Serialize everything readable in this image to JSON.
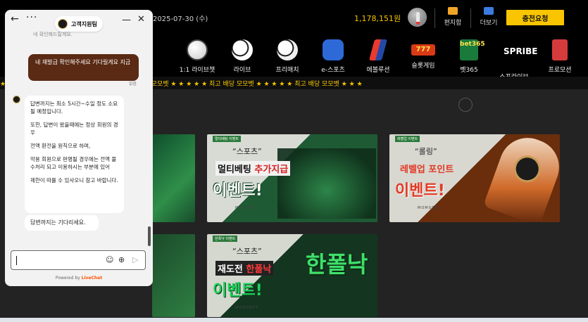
{
  "header": {
    "date": "2025-07-30 (수)",
    "balance": "1,178,151원",
    "mailbox_label": "편지함",
    "more_label": "더보기",
    "charge_label": "충전요청"
  },
  "nav": {
    "items": [
      {
        "label": "1:1 라이브챗",
        "icon": "live-chat-agent-icon"
      },
      {
        "label": "라이브",
        "icon": "live-soccer-icon"
      },
      {
        "label": "프리매치",
        "icon": "soccer-ball-icon"
      },
      {
        "label": "e-스포츠",
        "icon": "gamepad-icon"
      },
      {
        "label": "에볼루션",
        "icon": "evolution-logo-icon"
      },
      {
        "label": "슬롯게임",
        "icon": "slot-777-icon",
        "badge": "777"
      },
      {
        "label": "벳365",
        "icon": "bet365-logo-icon",
        "badge": "bet365"
      },
      {
        "label": "스프라이브",
        "icon": "spribe-logo-icon",
        "badge": "SPRIBE"
      },
      {
        "label": "프로모션",
        "icon": "gift-icon"
      }
    ]
  },
  "marquee": {
    "text": "★ ★ ★ ★ ★ 최고 배당 모모벳 ★ ★ ★ ★ ★ 최고 배당 모모벳 ★ ★ ★ ★ ★ 최고 배당 모모벳 ★ ★ ★ ★ ★ 최고 배당 모모벳 ★ ★ ★"
  },
  "banners": [
    {
      "id": "multi",
      "tag": "멀티베팅 이벤트",
      "quote": "“스포츠”",
      "line1_a": "멀티베팅 ",
      "line1_b": "추가지급",
      "line2": "이벤트!",
      "brand": "MOMOBET"
    },
    {
      "id": "rolling",
      "tag": "레벨업 이벤트",
      "quote": "“롤링”",
      "line1_a": "레벨업 포인트",
      "line1_b": "",
      "line2": "이벤트!",
      "brand": "MOMOBET"
    },
    {
      "id": "challenge",
      "tag": "한폭낙 이벤트",
      "quote": "“스포츠”",
      "line1_a": "재도전 ",
      "line1_b": "한폴낙",
      "line2": "이벤트!",
      "brand": "MOMOBET",
      "big": "한폴낙"
    }
  ],
  "chat": {
    "team_name": "고객지원팀",
    "cut_message": "네 확인해드릴게요.",
    "user_message": "네 재발급 확인해주세요 기다릴게요 지금",
    "read_label": "읽음",
    "agent_paragraphs": [
      "답변까지는 최소 5시간~수일 정도 소요될 예정입니다.",
      "또한, 답변이 왔을때에는 정상 회원의 경우",
      "전액 환전을 원칙으로 하며,",
      "악용 회원으로 판명될 경우에는 전액 몰수처리 되고 이용하시는 부분에 있어",
      "제한이 따를 수 있사오니 참고 바랍니다."
    ],
    "agent_message_2": "답변까지는 기다리세요.",
    "input_placeholder": "",
    "powered_by": "Powered by",
    "powered_brand": "LiveChat"
  }
}
